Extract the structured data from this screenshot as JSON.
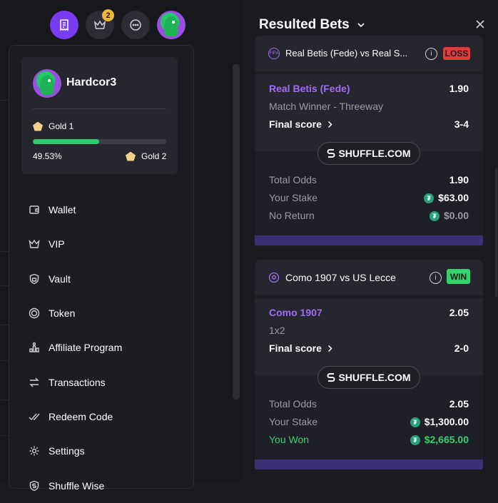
{
  "topbar": {
    "vip_badge_count": "2"
  },
  "user": {
    "name": "Hardcor3",
    "tier_current": "Gold 1",
    "tier_next": "Gold 2",
    "progress_pct": 49.53,
    "progress_label": "49.53%"
  },
  "menu": {
    "items": [
      {
        "label": "Wallet",
        "icon": "wallet-icon"
      },
      {
        "label": "VIP",
        "icon": "crown-icon"
      },
      {
        "label": "Vault",
        "icon": "lock-icon"
      },
      {
        "label": "Token",
        "icon": "token-icon"
      },
      {
        "label": "Affiliate Program",
        "icon": "affiliate-icon"
      },
      {
        "label": "Transactions",
        "icon": "transactions-icon"
      },
      {
        "label": "Redeem Code",
        "icon": "redeem-icon"
      },
      {
        "label": "Settings",
        "icon": "settings-icon"
      },
      {
        "label": "Shuffle Wise",
        "icon": "shuffle-wise-icon"
      }
    ]
  },
  "panel": {
    "title": "Resulted Bets"
  },
  "bets": [
    {
      "match": "Real Betis (Fede) vs Real S...",
      "status": "LOSS",
      "selection": "Real Betis (Fede)",
      "selection_odds": "1.90",
      "market": "Match Winner - Threeway",
      "final_score_label": "Final score",
      "final_score": "3-4",
      "brand": "SHUFFLE.COM",
      "total_odds_label": "Total Odds",
      "total_odds": "1.90",
      "stake_label": "Your Stake",
      "stake": "$63.00",
      "return_label": "No Return",
      "return_value": "$0.00"
    },
    {
      "match": "Como 1907 vs US Lecce",
      "status": "WIN",
      "selection": "Como 1907",
      "selection_odds": "2.05",
      "market": "1x2",
      "final_score_label": "Final score",
      "final_score": "2-0",
      "brand": "SHUFFLE.COM",
      "total_odds_label": "Total Odds",
      "total_odds": "2.05",
      "stake_label": "Your Stake",
      "stake": "$1,300.00",
      "return_label": "You Won",
      "return_value": "$2,665.00"
    }
  ],
  "colors": {
    "accent": "#7a3cf2",
    "win": "#37d26e",
    "loss": "#e53b3b",
    "progress": "#2fcb6c",
    "selection": "#a06cf5"
  }
}
